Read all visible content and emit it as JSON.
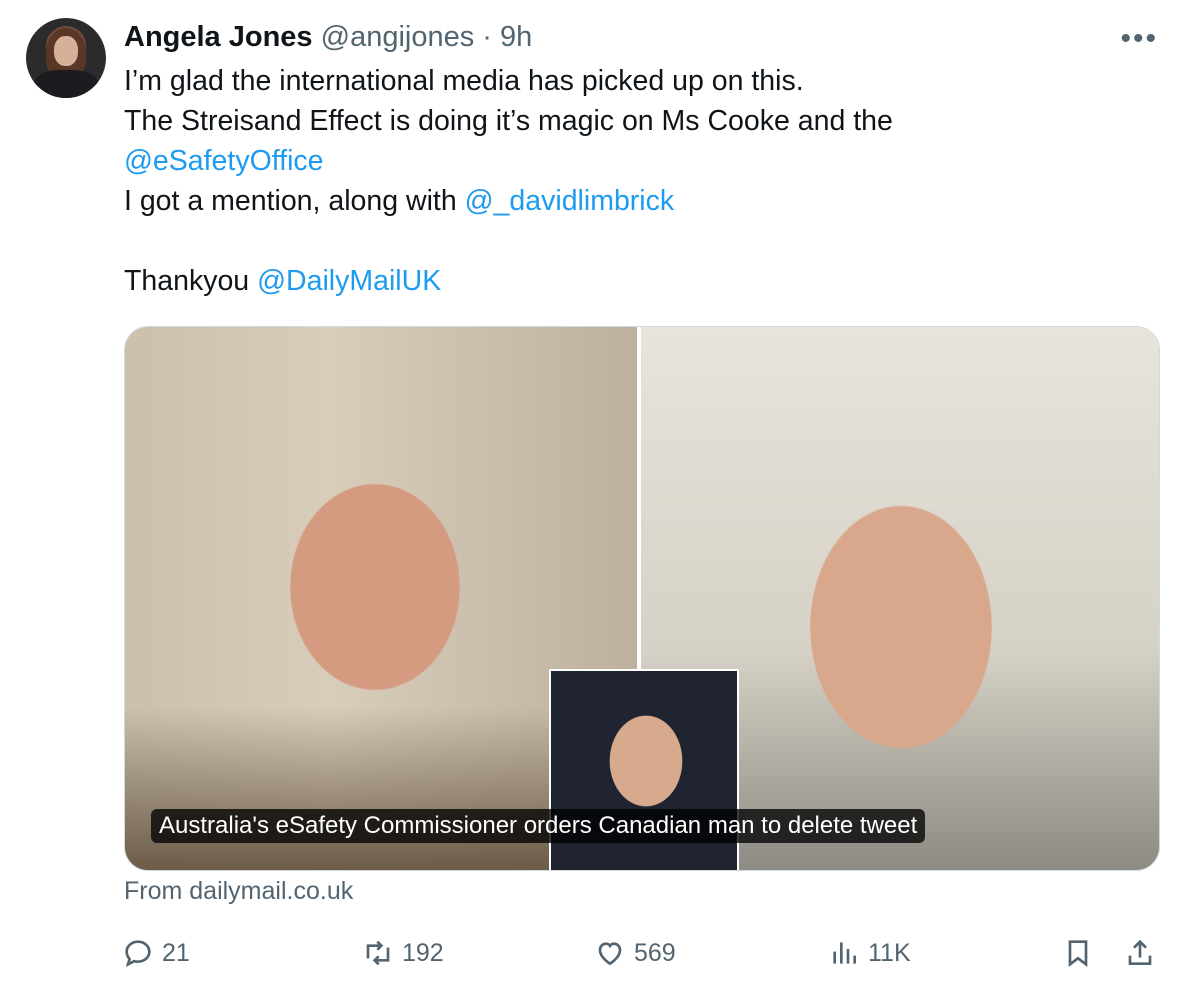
{
  "author": {
    "name": "Angela Jones",
    "handle": "@angijones",
    "separator": "·",
    "time": "9h"
  },
  "more_label": "•••",
  "tweet": {
    "line1": "I’m glad the international media has picked up on this.",
    "line2": "The Streisand Effect is doing it’s magic on Ms Cooke and the",
    "mention1": "@eSafetyOffice",
    "line4_prefix": "I got a mention, along with ",
    "mention2": "@_davidlimbrick",
    "line6_prefix": "Thankyou ",
    "mention3": "@DailyMailUK"
  },
  "card": {
    "caption": "Australia's eSafety Commissioner orders Canadian man to delete tweet",
    "source": "From dailymail.co.uk"
  },
  "actions": {
    "reply_count": "21",
    "retweet_count": "192",
    "like_count": "569",
    "views_count": "11K"
  },
  "icons": [
    "more-icon",
    "reply-icon",
    "retweet-icon",
    "like-icon",
    "views-icon",
    "bookmark-icon",
    "share-icon"
  ]
}
